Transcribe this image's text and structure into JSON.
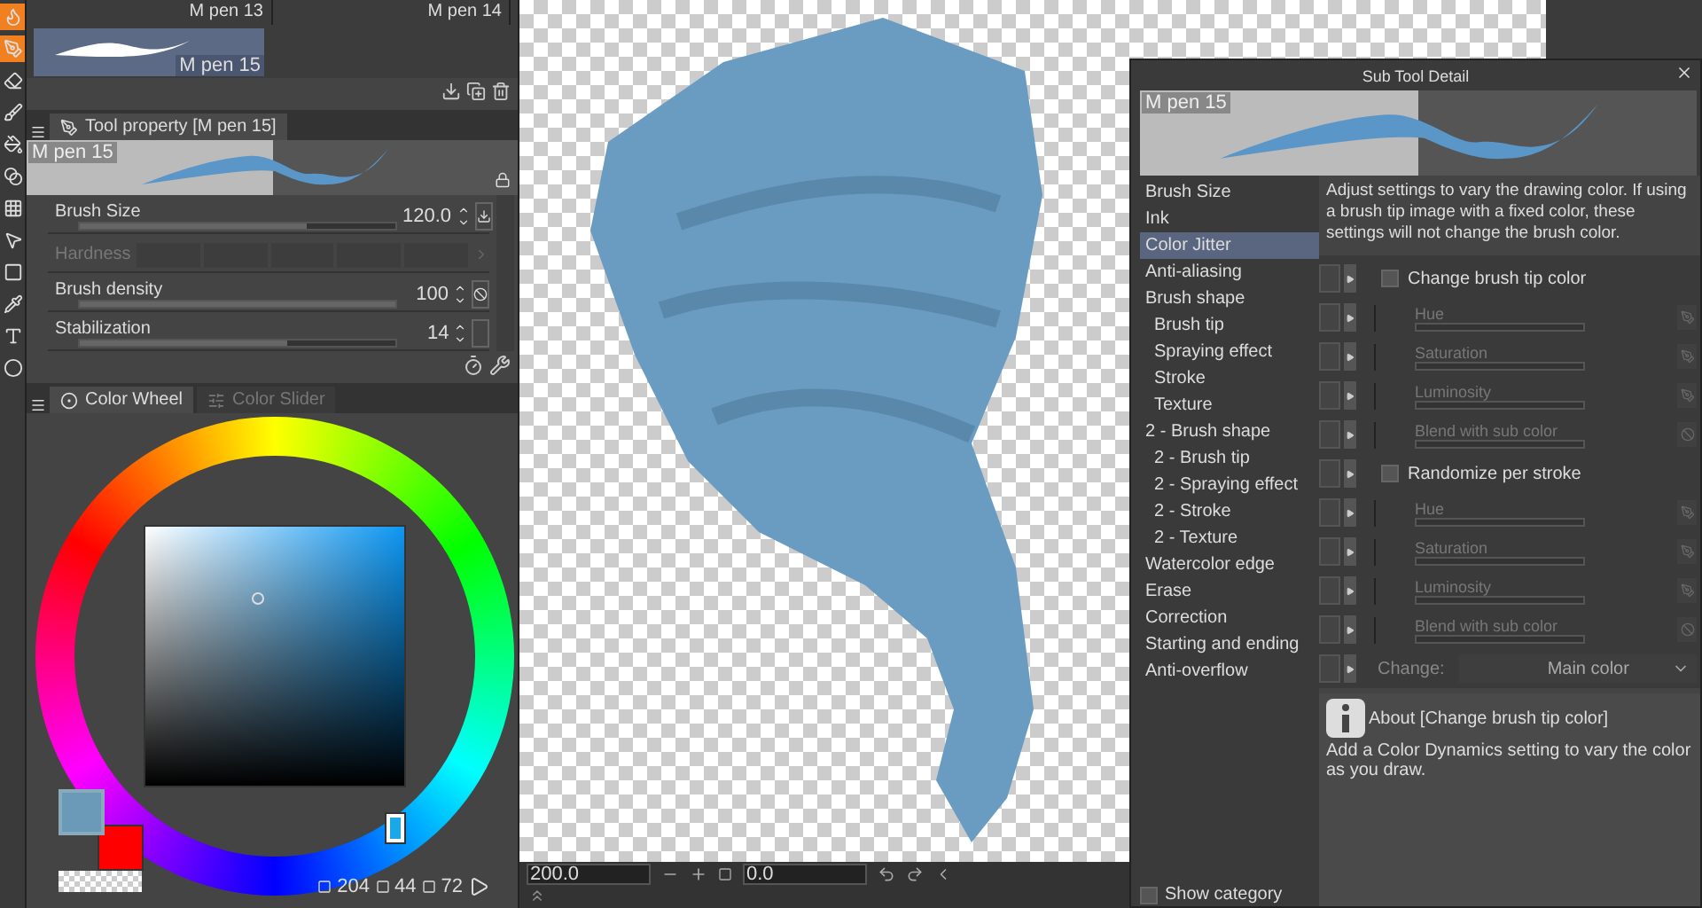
{
  "toolbar": {
    "tools": [
      {
        "kind": "droplet",
        "selected": true
      },
      {
        "kind": "pen",
        "selected": true
      },
      {
        "kind": "eraser",
        "selected": false
      },
      {
        "kind": "brush",
        "selected": false
      },
      {
        "kind": "fill",
        "selected": false
      },
      {
        "kind": "blend",
        "selected": false
      },
      {
        "kind": "grid",
        "selected": false
      },
      {
        "kind": "pointer",
        "selected": false
      },
      {
        "kind": "square",
        "selected": false
      },
      {
        "kind": "pipette",
        "selected": false
      },
      {
        "kind": "type",
        "selected": false
      },
      {
        "kind": "ellipse",
        "selected": false
      }
    ]
  },
  "brush_list": {
    "items": [
      {
        "name": "M pen 13",
        "selected": false
      },
      {
        "name": "M pen 14",
        "selected": false
      },
      {
        "name": "M pen 15",
        "selected": true
      }
    ]
  },
  "tool_property": {
    "tab": "Tool property [M pen 15]",
    "preview_label": "M pen 15",
    "properties": [
      {
        "kind": "slider",
        "label": "Brush Size",
        "value": "120.0",
        "level": 0.72
      },
      {
        "kind": "segments",
        "label": "Hardness"
      },
      {
        "kind": "slider",
        "label": "Brush density",
        "value": "100",
        "level": 1.0
      },
      {
        "kind": "slider",
        "label": "Stabilization",
        "value": "14",
        "level": 0.66
      }
    ]
  },
  "color_panel": {
    "tabs": [
      {
        "label": "Color Wheel",
        "selected": true
      },
      {
        "label": "Color Slider",
        "selected": false
      }
    ],
    "swatches": [
      {
        "kind": "main",
        "color": "#6a9ab8",
        "selected": true
      },
      {
        "kind": "sub",
        "color": "#ff0000",
        "selected": false
      }
    ],
    "values": [
      "204",
      "44",
      "72"
    ]
  },
  "canvas_bar": {
    "zoom": "200.0",
    "angle": "0.0"
  },
  "dialog": {
    "title": "Sub Tool Detail",
    "preview_label": "M pen 15",
    "categories": [
      {
        "label": "Brush Size",
        "selected": false
      },
      {
        "label": "Ink",
        "selected": false
      },
      {
        "label": "Color Jitter",
        "selected": true
      },
      {
        "label": "Anti-aliasing",
        "selected": false
      },
      {
        "label": "Brush shape",
        "selected": false,
        "children": [
          {
            "label": "Brush tip",
            "selected": false
          },
          {
            "label": "Spraying effect",
            "selected": false
          },
          {
            "label": "Stroke",
            "selected": false
          },
          {
            "label": "Texture",
            "selected": false
          }
        ]
      },
      {
        "label": "2 - Brush shape",
        "selected": false,
        "children": [
          {
            "label": "2 - Brush tip",
            "selected": false
          },
          {
            "label": "2 - Spraying effect",
            "selected": false
          },
          {
            "label": "2 - Stroke",
            "selected": false
          },
          {
            "label": "2 - Texture",
            "selected": false
          }
        ]
      },
      {
        "label": "Watercolor edge",
        "selected": false
      },
      {
        "label": "Erase",
        "selected": false
      },
      {
        "label": "Correction",
        "selected": false
      },
      {
        "label": "Starting and ending",
        "selected": false
      },
      {
        "label": "Anti-overflow",
        "selected": false
      }
    ],
    "description": "Adjust settings to vary the drawing color. If using a brush tip image with a fixed color, these settings will not change the brush color.",
    "groups": [
      {
        "label": "Change brush tip color",
        "checked": false,
        "params": [
          "Hue",
          "Saturation",
          "Luminosity",
          "Blend with sub color"
        ]
      },
      {
        "label": "Randomize per stroke",
        "checked": false,
        "params": [
          "Hue",
          "Saturation",
          "Luminosity",
          "Blend with sub color"
        ]
      }
    ],
    "change": {
      "label": "Change:",
      "value": "Main color"
    },
    "about": {
      "title": "About [Change brush tip color]",
      "text": "Add a Color Dynamics setting to vary the color as you draw."
    },
    "show_category": {
      "label": "Show category",
      "checked": false
    }
  }
}
